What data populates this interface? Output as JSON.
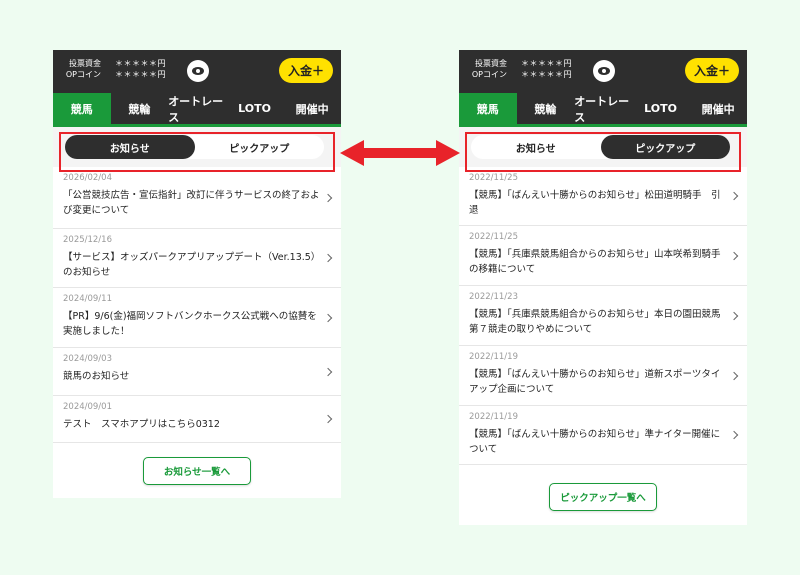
{
  "colors": {
    "accent": "#1a9a3a",
    "header_bg": "#2e2e2e",
    "deposit_bg": "#ffe100",
    "highlight": "#e8232a",
    "background": "#eefcf1"
  },
  "header": {
    "balance_label": "投票資金",
    "coin_label": "OPコイン",
    "balance_value": "＊＊＊＊＊円",
    "coin_value": "＊＊＊＊＊円",
    "eye_icon": "eye-icon",
    "deposit_label": "入金＋"
  },
  "nav": [
    "競馬",
    "競輪",
    "オートレース",
    "LOTO",
    "開催中"
  ],
  "tabs": {
    "news": "お知らせ",
    "pickup": "ピックアップ"
  },
  "left": {
    "items": [
      {
        "date": "2026/02/04",
        "title": "「公営競技広告・宣伝指針」改訂に伴うサービスの終了および変更について"
      },
      {
        "date": "2025/12/16",
        "title": "【サービス】オッズパークアプリアップデート（Ver.13.5）のお知らせ"
      },
      {
        "date": "2024/09/11",
        "title": "【PR】9/6(金)福岡ソフトバンクホークス公式戦への協賛を実施しました！"
      },
      {
        "date": "2024/09/03",
        "title": "競馬のお知らせ"
      },
      {
        "date": "2024/09/01",
        "title": "テスト　スマホアプリはこちら0312"
      }
    ],
    "more_label": "お知らせ一覧へ"
  },
  "right": {
    "items": [
      {
        "date": "2022/11/25",
        "title": "【競馬】「ばんえい十勝からのお知らせ」松田道明騎手　引退"
      },
      {
        "date": "2022/11/25",
        "title": "【競馬】「兵庫県競馬組合からのお知らせ」山本咲希到騎手の移籍について"
      },
      {
        "date": "2022/11/23",
        "title": "【競馬】「兵庫県競馬組合からのお知らせ」本日の園田競馬第７競走の取りやめについて"
      },
      {
        "date": "2022/11/19",
        "title": "【競馬】「ばんえい十勝からのお知らせ」道新スポーツタイアップ企画について"
      },
      {
        "date": "2022/11/19",
        "title": "【競馬】「ばんえい十勝からのお知らせ」準ナイター開催について"
      }
    ],
    "more_label": "ピックアップ一覧へ"
  }
}
